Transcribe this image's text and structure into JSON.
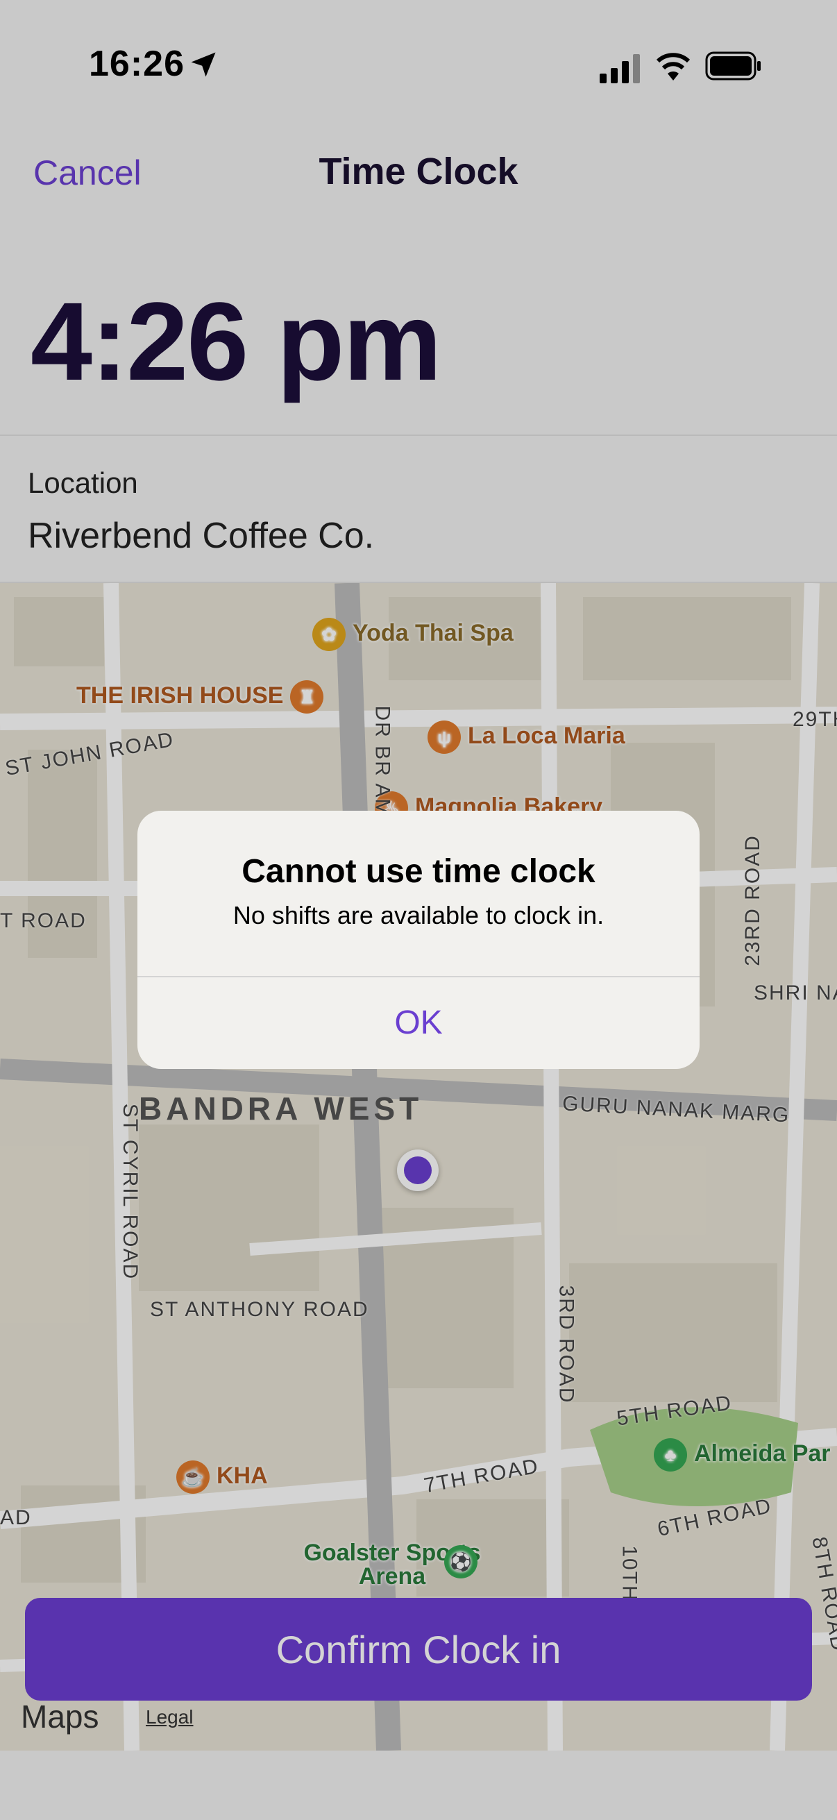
{
  "status_bar": {
    "time": "16:26"
  },
  "nav": {
    "cancel_label": "Cancel",
    "title": "Time Clock"
  },
  "clock": {
    "current_time": "4:26 pm"
  },
  "location": {
    "label": "Location",
    "value": "Riverbend Coffee Co."
  },
  "map": {
    "pois": [
      {
        "name": "Yoda Thai Spa",
        "color": "#e0a51c",
        "icon": "spa-icon"
      },
      {
        "name": "THE IRISH HOUSE",
        "color": "#e07a2c",
        "icon": "pub-icon"
      },
      {
        "name": "La Loca Maria",
        "color": "#e07a2c",
        "icon": "fork-knife-icon"
      },
      {
        "name": "Magnolia Bakery",
        "color": "#e07a2c",
        "icon": "bakery-icon"
      },
      {
        "name": "KHA",
        "color": "#e07a2c",
        "icon": "cafe-icon"
      },
      {
        "name": "Goalster Sports Arena",
        "color": "#34a853",
        "icon": "sports-icon"
      },
      {
        "name": "Almeida Par",
        "color": "#34a853",
        "icon": "park-icon"
      }
    ],
    "roads": [
      "ST JOHN ROAD",
      "DR BR AM",
      "29TH",
      "T ROAD",
      "23RD ROAD",
      "SHRI NA",
      "GURU NANAK MARG",
      "ST CYRIL ROAD",
      "ST ANTHONY ROAD",
      "3RD ROAD",
      "5TH ROAD",
      "7TH ROAD",
      "6TH ROAD",
      "AD",
      "10TH",
      "8TH ROAD"
    ],
    "area": "BANDRA WEST",
    "brand": "Maps",
    "legal": "Legal"
  },
  "confirm_button": {
    "label": "Confirm Clock in"
  },
  "alert": {
    "title": "Cannot use time clock",
    "message": "No shifts are available to clock in.",
    "ok_label": "OK"
  },
  "colors": {
    "accent": "#6b3ed2",
    "text_dark": "#1c0f3a"
  }
}
